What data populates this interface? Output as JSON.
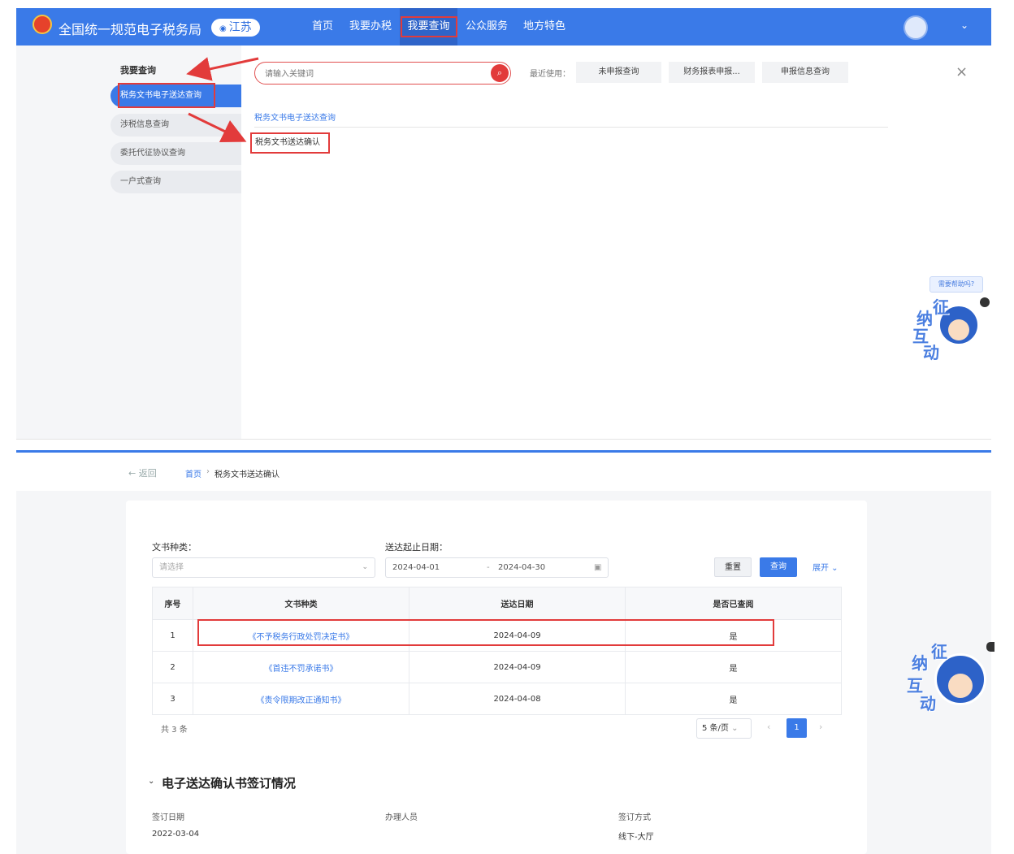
{
  "header": {
    "site_title": "全国统一规范电子税务局",
    "region": "江苏",
    "nav": [
      "首页",
      "我要办税",
      "我要查询",
      "公众服务",
      "地方特色"
    ],
    "nav_chevron": "⌄"
  },
  "side_menu": {
    "title": "我要查询",
    "items": [
      "税务文书电子送达查询",
      "涉税信息查询",
      "委托代征协议查询",
      "一户式查询"
    ]
  },
  "search": {
    "placeholder": "请输入关键词",
    "recent_label": "最近使用：",
    "quick_links": [
      "未申报查询",
      "财务报表申报...",
      "申报信息查询"
    ],
    "close": "×"
  },
  "results": {
    "category": "税务文书电子送达查询",
    "item": "税务文书送达确认"
  },
  "mascot": {
    "tip": "需要帮助吗?",
    "chars": [
      "纳",
      "征",
      "互",
      "动"
    ]
  },
  "breadcrumb": {
    "back": "← 返回",
    "home": "首页",
    "separator": "›",
    "current": "税务文书送达确认"
  },
  "filters": {
    "doc_type_label": "文书种类：",
    "doc_type_placeholder": "请选择",
    "date_label": "送达起止日期：",
    "date_start": "2024-04-01",
    "date_separator": "-",
    "date_end": "2024-04-30",
    "reset": "重置",
    "query": "查询",
    "expand": "展开 ⌄"
  },
  "table": {
    "headers": [
      "序号",
      "文书种类",
      "送达日期",
      "是否已查阅"
    ],
    "rows": [
      {
        "no": "1",
        "doc": "《不予税务行政处罚决定书》",
        "date": "2024-04-09",
        "read": "是"
      },
      {
        "no": "2",
        "doc": "《首违不罚承诺书》",
        "date": "2024-04-09",
        "read": "是"
      },
      {
        "no": "3",
        "doc": "《责令限期改正通知书》",
        "date": "2024-04-08",
        "read": "是"
      }
    ]
  },
  "pagination": {
    "total": "共 3 条",
    "page_size": "5 条/页",
    "prev": "‹",
    "current": "1",
    "next": "›"
  },
  "signing": {
    "section_title": "电子送达确认书签订情况",
    "labels": [
      "签订日期",
      "办理人员",
      "签订方式"
    ],
    "values": [
      "2022-03-04",
      "",
      "线下-大厅"
    ]
  },
  "colors": {
    "brand_blue": "#3a7ae8",
    "highlight_red": "#e23b3b"
  }
}
